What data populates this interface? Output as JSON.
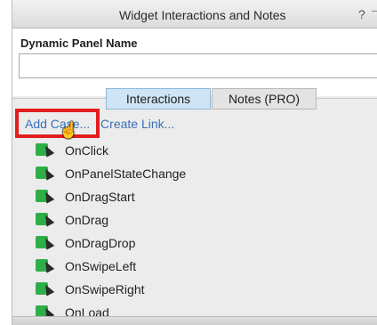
{
  "panel": {
    "title": "Widget Interactions and Notes",
    "help_glyph": "?",
    "field_label": "Dynamic Panel Name",
    "name_value": "",
    "name_placeholder": ""
  },
  "tabs": [
    {
      "label": "Interactions",
      "active": true
    },
    {
      "label": "Notes (PRO)",
      "active": false
    }
  ],
  "links": {
    "add_case": "Add Case...",
    "create_link": "Create Link..."
  },
  "events": [
    {
      "label": "OnClick",
      "icon": "interaction-event-icon"
    },
    {
      "label": "OnPanelStateChange",
      "icon": "interaction-event-icon"
    },
    {
      "label": "OnDragStart",
      "icon": "interaction-event-icon"
    },
    {
      "label": "OnDrag",
      "icon": "interaction-event-icon"
    },
    {
      "label": "OnDragDrop",
      "icon": "interaction-event-icon"
    },
    {
      "label": "OnSwipeLeft",
      "icon": "interaction-event-icon"
    },
    {
      "label": "OnSwipeRight",
      "icon": "interaction-event-icon"
    },
    {
      "label": "OnLoad",
      "icon": "interaction-event-icon"
    }
  ],
  "colors": {
    "accent_link": "#3a6fb8",
    "highlight": "#e31d1d",
    "event_icon": "#2fae48",
    "active_tab": "#cfe5f6"
  }
}
